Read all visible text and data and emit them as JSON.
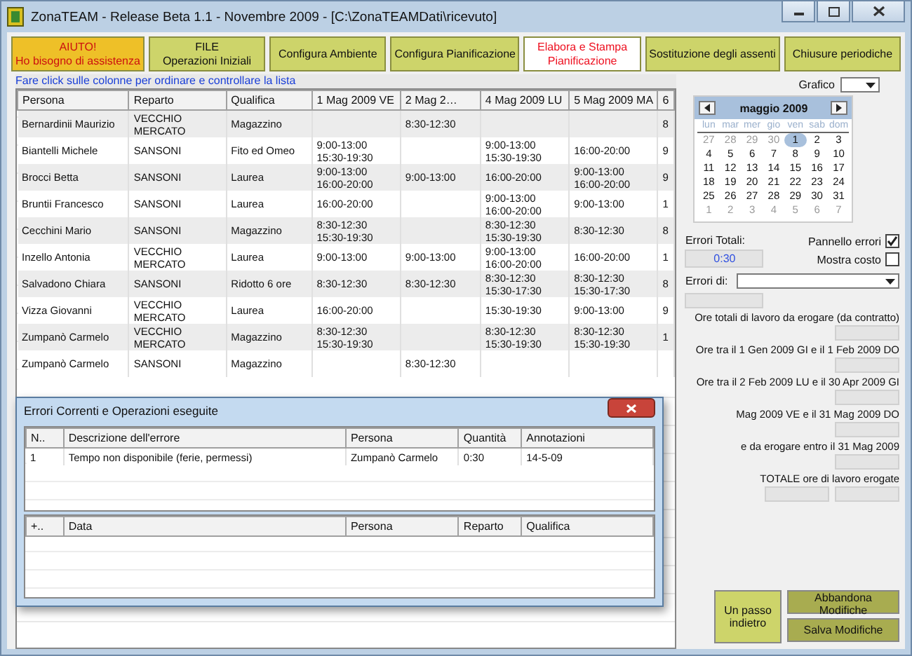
{
  "window": {
    "title": "ZonaTEAM - Release Beta 1.1 - Novembre 2009 - [C:\\ZonaTEAMDati\\ricevuto]"
  },
  "tabs": [
    {
      "kind": "help",
      "lines": [
        "AIUTO!",
        "Ho bisogno di assistenza"
      ],
      "selected": false
    },
    {
      "kind": "normal",
      "lines": [
        "FILE",
        "Operazioni Iniziali"
      ],
      "selected": false
    },
    {
      "kind": "normal",
      "lines": [
        "Configura Ambiente"
      ],
      "selected": false
    },
    {
      "kind": "normal",
      "lines": [
        "Configura Pianificazione"
      ],
      "selected": false
    },
    {
      "kind": "normal",
      "lines": [
        "Elabora e Stampa",
        "Pianificazione"
      ],
      "selected": true
    },
    {
      "kind": "normal",
      "lines": [
        "Sostituzione degli assenti"
      ],
      "selected": false
    },
    {
      "kind": "normal",
      "lines": [
        "Chiusure periodiche"
      ],
      "selected": false
    }
  ],
  "hint": "Fare click sulle colonne per ordinare e controllare la lista",
  "table": {
    "columns": [
      "Persona",
      "Reparto",
      "Qualifica",
      "1 Mag 2009 VE",
      "2 Mag 2…",
      "4 Mag 2009 LU",
      "5 Mag 2009 MA",
      "6"
    ],
    "rows": [
      {
        "cells": [
          "Bernardinii Maurizio",
          "VECCHIO MERCATO",
          "Magazzino",
          "",
          "8:30-12:30",
          "",
          "",
          "8"
        ]
      },
      {
        "cells": [
          "Biantelli Michele",
          "SANSONI",
          "Fito ed Omeo",
          "9:00-13:00 15:30-19:30",
          "",
          "9:00-13:00 15:30-19:30",
          "16:00-20:00",
          "9"
        ]
      },
      {
        "cells": [
          "Brocci Betta",
          "SANSONI",
          "Laurea",
          "9:00-13:00 16:00-20:00",
          "9:00-13:00",
          "16:00-20:00",
          "9:00-13:00 16:00-20:00",
          "9"
        ]
      },
      {
        "cells": [
          "Bruntii Francesco",
          "SANSONI",
          "Laurea",
          "16:00-20:00",
          "",
          "9:00-13:00 16:00-20:00",
          "9:00-13:00",
          "1"
        ]
      },
      {
        "cells": [
          "Cecchini Mario",
          "SANSONI",
          "Magazzino",
          "8:30-12:30 15:30-19:30",
          "",
          "8:30-12:30 15:30-19:30",
          "8:30-12:30",
          "8"
        ]
      },
      {
        "cells": [
          "Inzello Antonia",
          "VECCHIO MERCATO",
          "Laurea",
          "9:00-13:00",
          "9:00-13:00",
          "9:00-13:00 16:00-20:00",
          "16:00-20:00",
          "1"
        ]
      },
      {
        "cells": [
          "Salvadono Chiara",
          "SANSONI",
          "Ridotto 6 ore",
          "8:30-12:30",
          "8:30-12:30",
          "8:30-12:30 15:30-17:30",
          "8:30-12:30 15:30-17:30",
          "8"
        ]
      },
      {
        "cells": [
          "Vizza Giovanni",
          "VECCHIO MERCATO",
          "Laurea",
          "16:00-20:00",
          "",
          "15:30-19:30",
          "9:00-13:00",
          "9"
        ]
      },
      {
        "cells": [
          "Zumpanò Carmelo",
          "VECCHIO MERCATO",
          "Magazzino",
          "8:30-12:30 15:30-19:30",
          "",
          "8:30-12:30 15:30-19:30",
          "8:30-12:30 15:30-19:30",
          "1"
        ]
      },
      {
        "cells": [
          "Zumpanò Carmelo",
          "SANSONI",
          "Magazzino",
          "",
          "8:30-12:30",
          "",
          "",
          ""
        ]
      }
    ]
  },
  "chart_select": {
    "label": "Grafico"
  },
  "calendar": {
    "month": "maggio 2009",
    "weekdays": [
      "lun",
      "mar",
      "mer",
      "gio",
      "ven",
      "sab",
      "dom"
    ],
    "days": [
      {
        "day": "27",
        "muted": true,
        "selected": false
      },
      {
        "day": "28",
        "muted": true,
        "selected": false
      },
      {
        "day": "29",
        "muted": true,
        "selected": false
      },
      {
        "day": "30",
        "muted": true,
        "selected": false
      },
      {
        "day": "1",
        "muted": false,
        "selected": true
      },
      {
        "day": "2",
        "muted": false,
        "selected": false
      },
      {
        "day": "3",
        "muted": false,
        "selected": false
      },
      {
        "day": "4",
        "muted": false,
        "selected": false
      },
      {
        "day": "5",
        "muted": false,
        "selected": false
      },
      {
        "day": "6",
        "muted": false,
        "selected": false
      },
      {
        "day": "7",
        "muted": false,
        "selected": false
      },
      {
        "day": "8",
        "muted": false,
        "selected": false
      },
      {
        "day": "9",
        "muted": false,
        "selected": false
      },
      {
        "day": "10",
        "muted": false,
        "selected": false
      },
      {
        "day": "11",
        "muted": false,
        "selected": false
      },
      {
        "day": "12",
        "muted": false,
        "selected": false
      },
      {
        "day": "13",
        "muted": false,
        "selected": false
      },
      {
        "day": "14",
        "muted": false,
        "selected": false
      },
      {
        "day": "15",
        "muted": false,
        "selected": false
      },
      {
        "day": "16",
        "muted": false,
        "selected": false
      },
      {
        "day": "17",
        "muted": false,
        "selected": false
      },
      {
        "day": "18",
        "muted": false,
        "selected": false
      },
      {
        "day": "19",
        "muted": false,
        "selected": false
      },
      {
        "day": "20",
        "muted": false,
        "selected": false
      },
      {
        "day": "21",
        "muted": false,
        "selected": false
      },
      {
        "day": "22",
        "muted": false,
        "selected": false
      },
      {
        "day": "23",
        "muted": false,
        "selected": false
      },
      {
        "day": "24",
        "muted": false,
        "selected": false
      },
      {
        "day": "25",
        "muted": false,
        "selected": false
      },
      {
        "day": "26",
        "muted": false,
        "selected": false
      },
      {
        "day": "27",
        "muted": false,
        "selected": false
      },
      {
        "day": "28",
        "muted": false,
        "selected": false
      },
      {
        "day": "29",
        "muted": false,
        "selected": false
      },
      {
        "day": "30",
        "muted": false,
        "selected": false
      },
      {
        "day": "31",
        "muted": false,
        "selected": false
      },
      {
        "day": "1",
        "muted": true,
        "selected": false
      },
      {
        "day": "2",
        "muted": true,
        "selected": false
      },
      {
        "day": "3",
        "muted": true,
        "selected": false
      },
      {
        "day": "4",
        "muted": true,
        "selected": false
      },
      {
        "day": "5",
        "muted": true,
        "selected": false
      },
      {
        "day": "6",
        "muted": true,
        "selected": false
      },
      {
        "day": "7",
        "muted": true,
        "selected": false
      }
    ]
  },
  "errors_total": {
    "label": "Errori Totali:",
    "value": "0:30"
  },
  "checkboxes": [
    {
      "label": "Pannello errori",
      "checked": true
    },
    {
      "label": "Mostra costo",
      "checked": false
    }
  ],
  "errors_of": {
    "label": "Errori di:"
  },
  "summary": [
    {
      "label": "Ore totali di lavoro da erogare (da contratto)",
      "kind": "single"
    },
    {
      "label": "Ore tra il 1 Gen 2009 GI e il 1 Feb 2009 DO",
      "kind": "single"
    },
    {
      "label": "Ore tra il 2 Feb 2009 LU e il 30 Apr 2009 GI",
      "kind": "single"
    },
    {
      "label": "Mag 2009 VE e il 31 Mag 2009 DO",
      "kind": "single"
    },
    {
      "label": "e da erogare entro il 31 Mag 2009",
      "kind": "single"
    },
    {
      "label": "TOTALE ore di lavoro erogate",
      "kind": "double"
    }
  ],
  "buttons": [
    {
      "label": "Un passo indietro",
      "kind": "back"
    },
    {
      "label": "Abbandona Modifiche",
      "kind": "action"
    },
    {
      "label": "Salva Modifiche",
      "kind": "action"
    }
  ],
  "dialog": {
    "title": "Errori Correnti e Operazioni eseguite",
    "errors_table": {
      "columns": [
        "N..",
        "Descrizione dell'errore",
        "Persona",
        "Quantità",
        "Annotazioni"
      ],
      "rows": [
        [
          "1",
          "Tempo non disponibile (ferie, permessi)",
          "Zumpanò Carmelo",
          "0:30",
          "14-5-09"
        ]
      ]
    },
    "operations_table": {
      "columns": [
        "+..",
        "Data",
        "Persona",
        "Reparto",
        "Qualifica"
      ]
    }
  }
}
